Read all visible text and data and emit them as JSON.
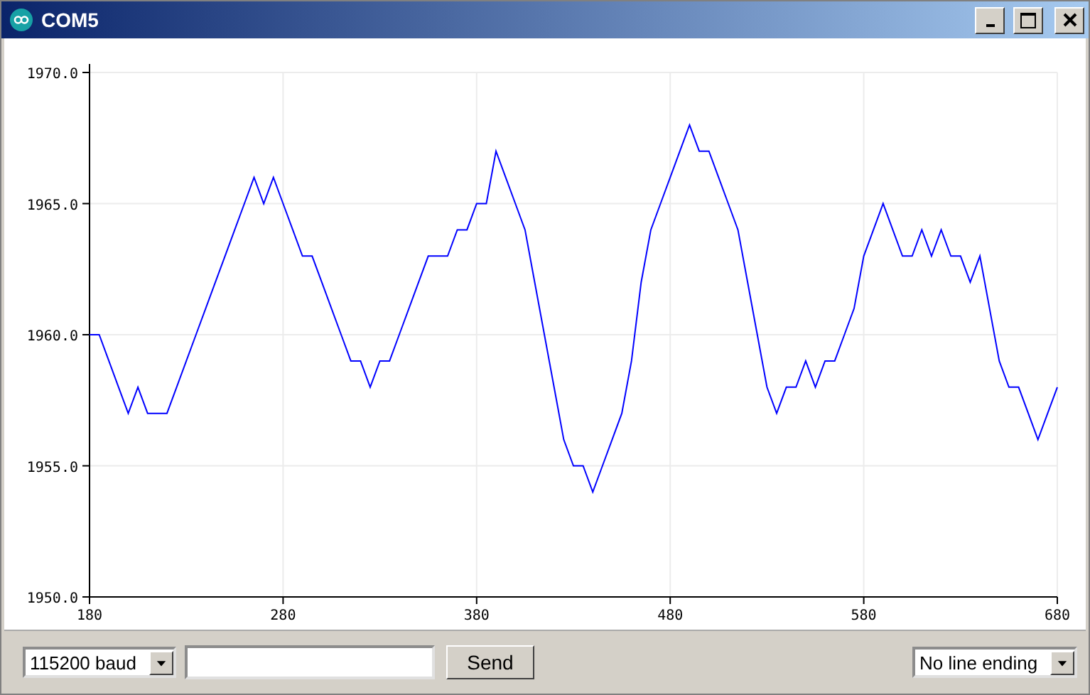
{
  "window": {
    "title": "COM5"
  },
  "plot": {
    "chart_data": {
      "type": "line",
      "grid": true,
      "xlim": [
        180,
        680
      ],
      "ylim": [
        1950,
        1970
      ],
      "xticks": [
        180,
        280,
        380,
        480,
        580,
        680
      ],
      "yticks": [
        {
          "value": 1950,
          "label": "1950.0"
        },
        {
          "value": 1955,
          "label": "1955.0"
        },
        {
          "value": 1960,
          "label": "1960.0"
        },
        {
          "value": 1965,
          "label": "1965.0"
        },
        {
          "value": 1970,
          "label": "1970.0"
        }
      ],
      "x": [
        180,
        185,
        190,
        195,
        200,
        205,
        210,
        215,
        220,
        225,
        230,
        235,
        240,
        245,
        250,
        255,
        260,
        265,
        270,
        275,
        280,
        285,
        290,
        295,
        300,
        305,
        310,
        315,
        320,
        325,
        330,
        335,
        340,
        345,
        350,
        355,
        360,
        365,
        370,
        375,
        380,
        385,
        390,
        395,
        400,
        405,
        410,
        415,
        420,
        425,
        430,
        435,
        440,
        445,
        450,
        455,
        460,
        465,
        470,
        475,
        480,
        485,
        490,
        495,
        500,
        505,
        510,
        515,
        520,
        525,
        530,
        535,
        540,
        545,
        550,
        555,
        560,
        565,
        570,
        575,
        580,
        585,
        590,
        595,
        600,
        605,
        610,
        615,
        620,
        625,
        630,
        635,
        640,
        645,
        650,
        655,
        660,
        665,
        670,
        675,
        680
      ],
      "series": [
        {
          "color": "#0000ff",
          "values": [
            1960,
            1960,
            1959,
            1958,
            1957,
            1958,
            1957,
            1957,
            1957,
            1958,
            1959,
            1960,
            1961,
            1962,
            1963,
            1964,
            1965,
            1966,
            1965,
            1966,
            1965,
            1964,
            1963,
            1963,
            1962,
            1961,
            1960,
            1959,
            1959,
            1958,
            1959,
            1959,
            1960,
            1961,
            1962,
            1963,
            1963,
            1963,
            1964,
            1964,
            1965,
            1965,
            1967,
            1966,
            1965,
            1964,
            1962,
            1960,
            1958,
            1956,
            1955,
            1955,
            1954,
            1955,
            1956,
            1957,
            1959,
            1962,
            1964,
            1965,
            1966,
            1967,
            1968,
            1967,
            1967,
            1966,
            1965,
            1964,
            1962,
            1960,
            1958,
            1957,
            1958,
            1958,
            1959,
            1958,
            1959,
            1959,
            1960,
            1961,
            1963,
            1964,
            1965,
            1964,
            1963,
            1963,
            1964,
            1963,
            1964,
            1963,
            1963,
            1962,
            1963,
            1961,
            1959,
            1958,
            1958,
            1957,
            1956,
            1957,
            1958
          ]
        }
      ]
    }
  },
  "controls": {
    "baud": "115200 baud",
    "send": "Send",
    "line_ending": "No line ending"
  }
}
